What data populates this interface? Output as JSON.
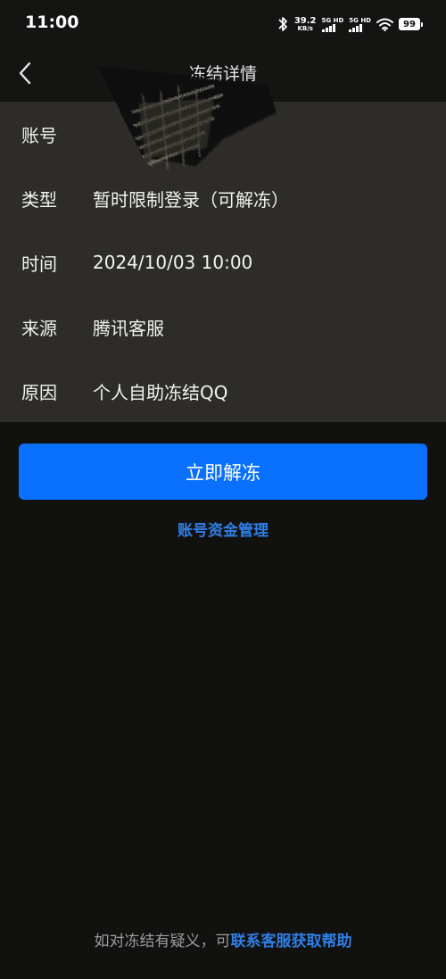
{
  "status_bar": {
    "time": "11:00",
    "net_speed_value": "39.2",
    "net_speed_unit": "KB/s",
    "sim1_label": "5G HD",
    "sim2_label": "5G HD",
    "battery_level": "99"
  },
  "nav": {
    "title": "冻结详情",
    "back_icon": "chevron-left-icon"
  },
  "details": {
    "rows": [
      {
        "label": "账号",
        "value": ""
      },
      {
        "label": "类型",
        "value": "暂时限制登录（可解冻）"
      },
      {
        "label": "时间",
        "value": "2024/10/03 10:00"
      },
      {
        "label": "来源",
        "value": "腾讯客服"
      },
      {
        "label": "原因",
        "value": "个人自助冻结QQ"
      }
    ]
  },
  "actions": {
    "unfreeze_label": "立即解冻",
    "fund_management_label": "账号资金管理"
  },
  "footer": {
    "prefix": "如对冻结有疑义，可",
    "link": "联系客服获取帮助"
  },
  "colors": {
    "background": "#111110",
    "card": "#2d2c29",
    "accent": "#0a70ff",
    "link": "#2f7fe6"
  }
}
